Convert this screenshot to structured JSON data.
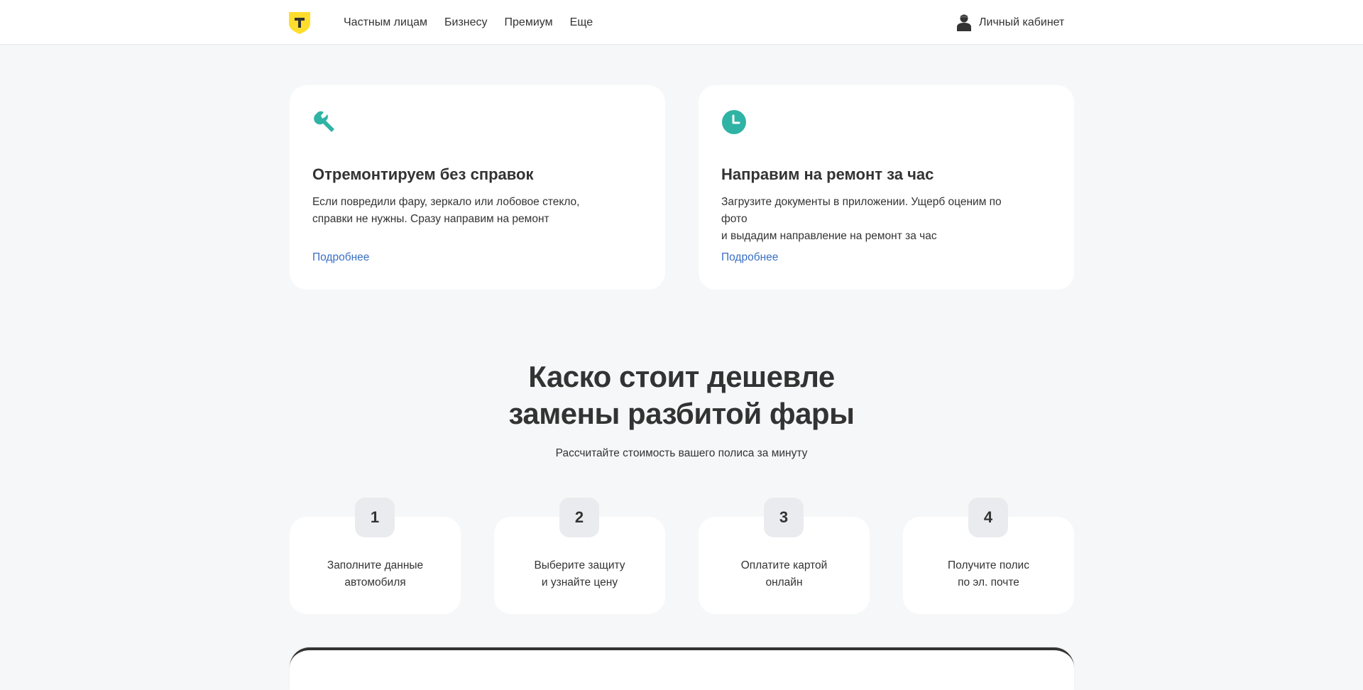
{
  "header": {
    "nav": [
      "Частным лицам",
      "Бизнесу",
      "Премиум",
      "Еще"
    ],
    "account_label": "Личный кабинет",
    "logo_color": "#ffdd2d"
  },
  "features": [
    {
      "icon": "wrench-icon",
      "title": "Отремонтируем без справок",
      "line1": "Если повредили фару, зеркало или лобовое стекло,",
      "line2": "справки не нужны. Сразу направим на ремонт",
      "link": "Подробнее"
    },
    {
      "icon": "clock-icon",
      "title": "Направим на ремонт за час",
      "line1": "Загрузите документы в приложении. Ущерб оценим по фото",
      "line2": "и выдадим направление на ремонт за час",
      "link": "Подробнее"
    }
  ],
  "promo": {
    "headline_line1": "Каско стоит дешевле",
    "headline_line2": "замены разбитой фары",
    "subhead": "Рассчитайте стоимость вашего полиса за минуту"
  },
  "steps": [
    {
      "num": "1",
      "line1": "Заполните данные",
      "line2": "автомобиля"
    },
    {
      "num": "2",
      "line1": "Выберите защиту",
      "line2": "и узнайте цену"
    },
    {
      "num": "3",
      "line1": "Оплатите картой",
      "line2": "онлайн"
    },
    {
      "num": "4",
      "line1": "Получите полис",
      "line2": "по эл. почте"
    }
  ],
  "colors": {
    "accent_teal": "#2fb3a5",
    "link_blue": "#3a6fc4",
    "page_bg": "#f6f7f8"
  }
}
